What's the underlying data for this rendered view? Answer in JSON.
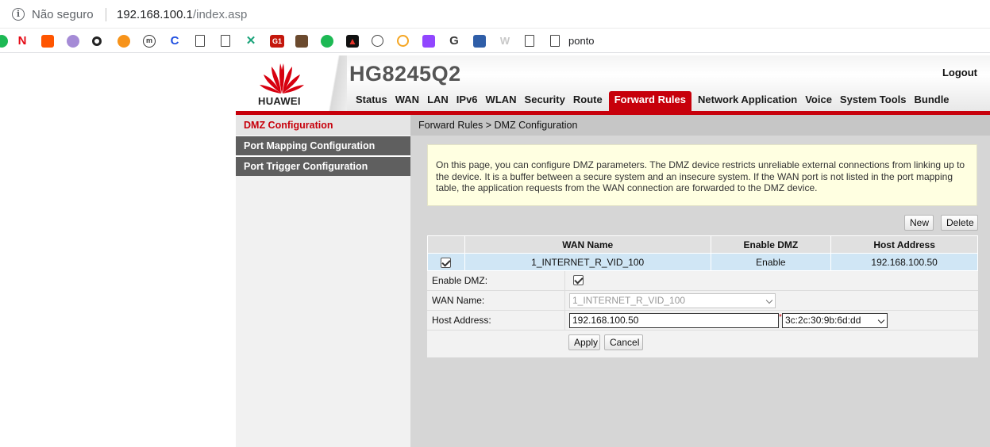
{
  "browser": {
    "security_label": "Não seguro",
    "url_host": "192.168.100.1",
    "url_path": "/index.asp",
    "bookmark_label": "ponto"
  },
  "header": {
    "brand": "HUAWEI",
    "model": "HG8245Q2",
    "logout_label": "Logout",
    "accent_color": "#c7000b"
  },
  "nav": {
    "items": [
      "Status",
      "WAN",
      "LAN",
      "IPv6",
      "WLAN",
      "Security",
      "Route",
      "Forward Rules",
      "Network Application",
      "Voice",
      "System Tools",
      "Bundle"
    ],
    "active": "Forward Rules"
  },
  "sidebar": {
    "items": [
      "DMZ Configuration",
      "Port Mapping Configuration",
      "Port Trigger Configuration"
    ]
  },
  "main": {
    "breadcrumb": "Forward Rules > DMZ Configuration",
    "notice": "On this page, you can configure DMZ parameters. The DMZ device restricts unreliable external connections from linking up to the device. It is a buffer between a secure system and an insecure system. If the WAN port is not listed in the port mapping table, the application requests from the WAN connection are forwarded to the DMZ device.",
    "new_label": "New",
    "delete_label": "Delete",
    "table": {
      "headers": [
        "WAN Name",
        "Enable DMZ",
        "Host Address"
      ],
      "rows": [
        {
          "wan_name": "1_INTERNET_R_VID_100",
          "enable_dmz": "Enable",
          "host_address": "192.168.100.50"
        }
      ]
    },
    "form": {
      "enable_label": "Enable DMZ:",
      "wan_label": "WAN Name:",
      "wan_value": "1_INTERNET_R_VID_100",
      "host_label": "Host Address:",
      "host_value": "192.168.100.50",
      "required_mark": "*",
      "mac_value": "3c:2c:30:9b:6d:dd",
      "apply_label": "Apply",
      "cancel_label": "Cancel"
    }
  }
}
